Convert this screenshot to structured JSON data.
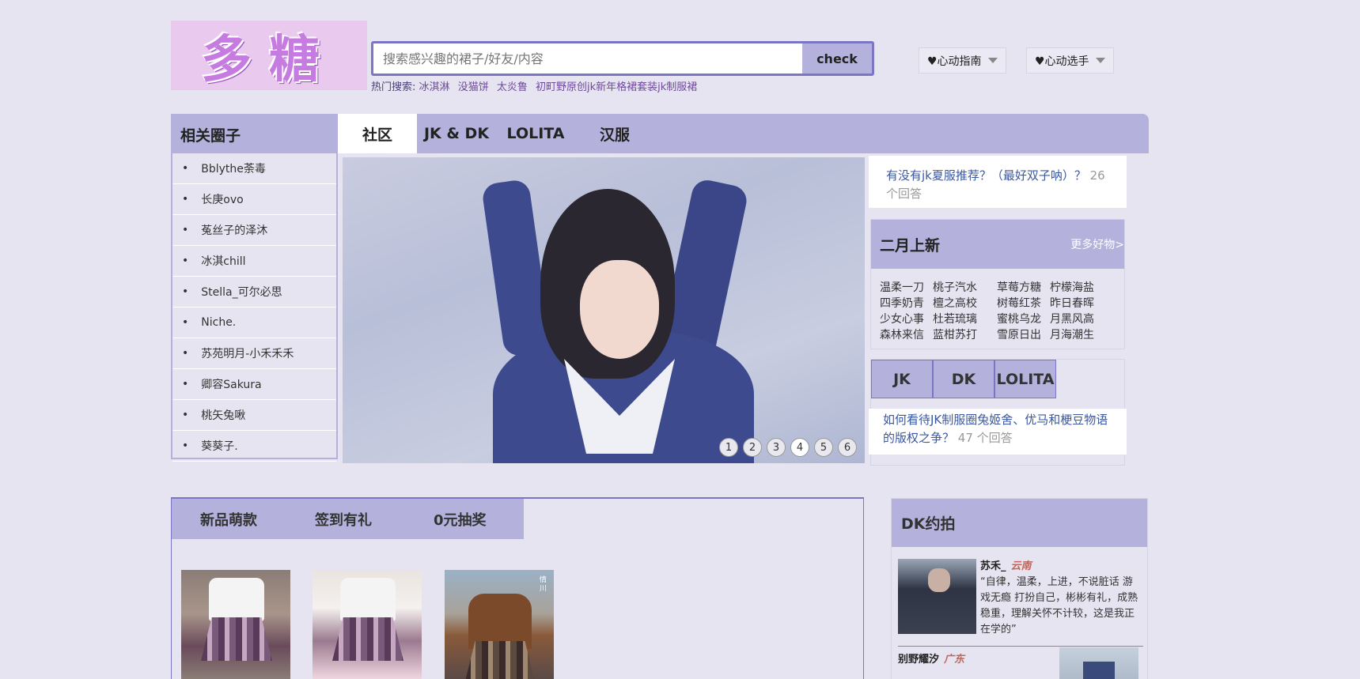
{
  "brand": {
    "logo_text": "多糖"
  },
  "search": {
    "placeholder": "搜索感兴趣的裙子/好友/内容",
    "button": "check"
  },
  "hot_search": {
    "label": "热门搜索:",
    "items": [
      "冰淇淋",
      "没猫饼",
      "太炎鲁",
      "初町野原创jk新年格裙套装jk制服裙"
    ]
  },
  "dropdowns": [
    {
      "label": "♥心动指南"
    },
    {
      "label": "♥心动选手"
    }
  ],
  "sidebar": {
    "title": "相关圈子",
    "items": [
      {
        "label": "Bblythe荼毒"
      },
      {
        "label": "长庚ovo"
      },
      {
        "label": "菟丝子的泽沐"
      },
      {
        "label": "冰淇chill"
      },
      {
        "label": "Stella_可尔必思"
      },
      {
        "label": "Niche."
      },
      {
        "label": "苏苑明月-小禾禾禾"
      },
      {
        "label": "卿容Sakura"
      },
      {
        "label": "桃矢兔啾"
      },
      {
        "label": "葵葵子."
      }
    ]
  },
  "nav": {
    "tabs": [
      {
        "label": "社区"
      },
      {
        "label": "JK & DK"
      },
      {
        "label": "LOLITA"
      },
      {
        "label": "汉服"
      }
    ]
  },
  "carousel": {
    "dots": [
      "1",
      "2",
      "3",
      "4",
      "5",
      "6"
    ]
  },
  "question1": {
    "text": "有没有jk夏服推荐？（最好双子呐）？",
    "count": "26 个回答"
  },
  "february": {
    "title": "二月上新",
    "more": "更多好物>",
    "items": [
      "温柔一刀",
      "桃子汽水",
      "草莓方糖",
      "柠檬海盐",
      "四季奶青",
      "檀之高校",
      "树莓红茶",
      "昨日春晖",
      "少女心事",
      "杜若琉璃",
      "蜜桃乌龙",
      "月黑风高",
      "森林来信",
      "蓝柑苏打",
      "雪原日出",
      "月海潮生"
    ]
  },
  "category_tabs": [
    {
      "label": "JK"
    },
    {
      "label": "DK"
    },
    {
      "label": "LOLITA"
    }
  ],
  "question2": {
    "text": "如何看待JK制服圈兔姬舍、优马和梗豆物语的版权之争？",
    "count": "47 个回答"
  },
  "lower_tabs": [
    {
      "label": "新品萌款"
    },
    {
      "label": "签到有礼"
    },
    {
      "label": "0元抽奖"
    }
  ],
  "thumb3_text": "情川",
  "dk_section": {
    "title": "DK约拍",
    "post1": {
      "name": "苏禾_",
      "location": "云南",
      "quote": "“自律，温柔，上进，不说脏话 游戏无瘾 打扮自己，彬彬有礼，成熟稳重，理解关怀不计较，这是我正在学的”"
    },
    "post2": {
      "name": "别野耀汐",
      "location": "广东"
    }
  },
  "colors": {
    "background": "#e6e4f1",
    "accent": "#b4b2dc",
    "border": "#7a76c4",
    "link": "#3a57a0"
  }
}
